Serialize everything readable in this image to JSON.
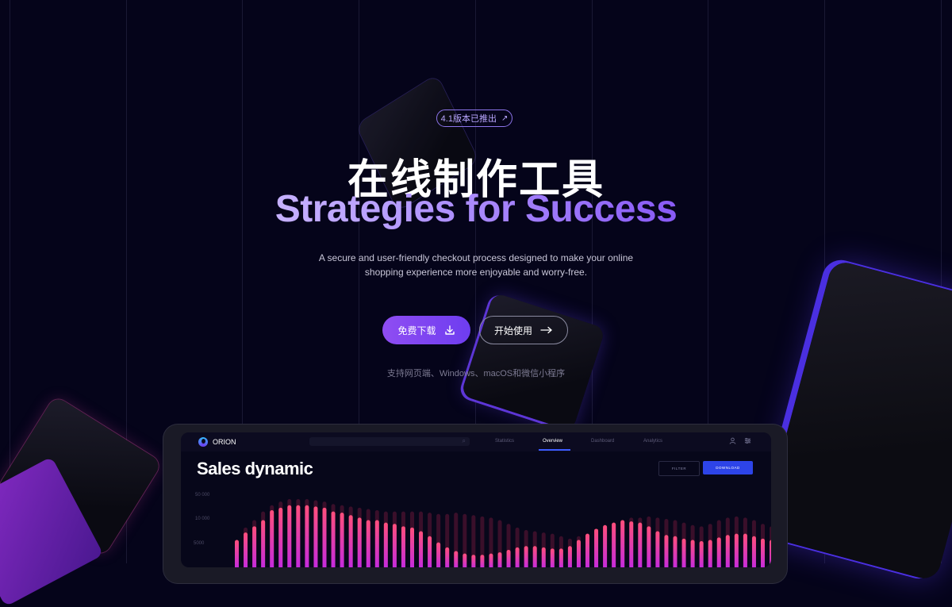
{
  "hero": {
    "badge_text": "4.1版本已推出",
    "badge_icon": "arrow-up-right-icon",
    "title": "在线制作工具",
    "subtitle": "Strategies for Success",
    "description_line1": "A secure and user-friendly checkout process designed to make your online",
    "description_line2": "shopping experience more enjoyable and worry-free.",
    "primary_button": "免费下载",
    "primary_button_icon": "download-icon",
    "secondary_button": "开始使用",
    "secondary_button_icon": "arrow-right-icon",
    "platforms": "支持网页端、Windows、macOS和微信小程序"
  },
  "dashboard": {
    "brand": "ORION",
    "tabs": [
      "Statistics",
      "Overview",
      "Dashboard",
      "Analytics"
    ],
    "active_tab": "Overview",
    "title": "Sales dynamic",
    "filter_button": "FILTER",
    "download_button": "DOWNLOAD",
    "icons": [
      "search-icon",
      "user-icon",
      "settings-sliders-icon"
    ]
  },
  "chart_data": {
    "type": "bar",
    "title": "Sales dynamic",
    "y_ticks": [
      "50 000",
      "10 000",
      "5000"
    ],
    "series": [
      {
        "values": [
          0.34,
          0.46,
          0.56,
          0.66,
          0.82,
          0.86,
          0.9,
          0.9,
          0.9,
          0.88,
          0.86,
          0.8,
          0.78,
          0.74,
          0.7,
          0.66,
          0.66,
          0.62,
          0.6,
          0.56,
          0.54,
          0.48,
          0.4,
          0.3,
          0.22,
          0.16,
          0.12,
          0.1,
          0.1,
          0.12,
          0.14,
          0.18,
          0.22,
          0.24,
          0.24,
          0.22,
          0.2,
          0.2,
          0.24,
          0.34,
          0.44,
          0.52,
          0.58,
          0.62,
          0.66,
          0.64,
          0.62,
          0.56,
          0.48,
          0.42,
          0.4,
          0.36,
          0.34,
          0.32,
          0.34,
          0.38,
          0.42,
          0.44,
          0.44,
          0.4,
          0.36,
          0.34
        ]
      },
      {
        "values": [
          0.34,
          0.54,
          0.66,
          0.8,
          0.9,
          0.96,
          1.0,
          1.0,
          1.0,
          0.98,
          0.96,
          0.92,
          0.9,
          0.88,
          0.86,
          0.84,
          0.82,
          0.8,
          0.8,
          0.8,
          0.8,
          0.8,
          0.78,
          0.76,
          0.76,
          0.78,
          0.76,
          0.74,
          0.72,
          0.7,
          0.66,
          0.6,
          0.54,
          0.5,
          0.48,
          0.46,
          0.44,
          0.4,
          0.36,
          0.4,
          0.44,
          0.5,
          0.56,
          0.62,
          0.66,
          0.7,
          0.7,
          0.72,
          0.7,
          0.68,
          0.66,
          0.62,
          0.58,
          0.56,
          0.6,
          0.66,
          0.7,
          0.72,
          0.7,
          0.66,
          0.6,
          0.56
        ]
      }
    ],
    "colors": {
      "top": "#ff4f7b",
      "bottom": "#c32ae0",
      "shadow": "#3a0f2a"
    }
  }
}
